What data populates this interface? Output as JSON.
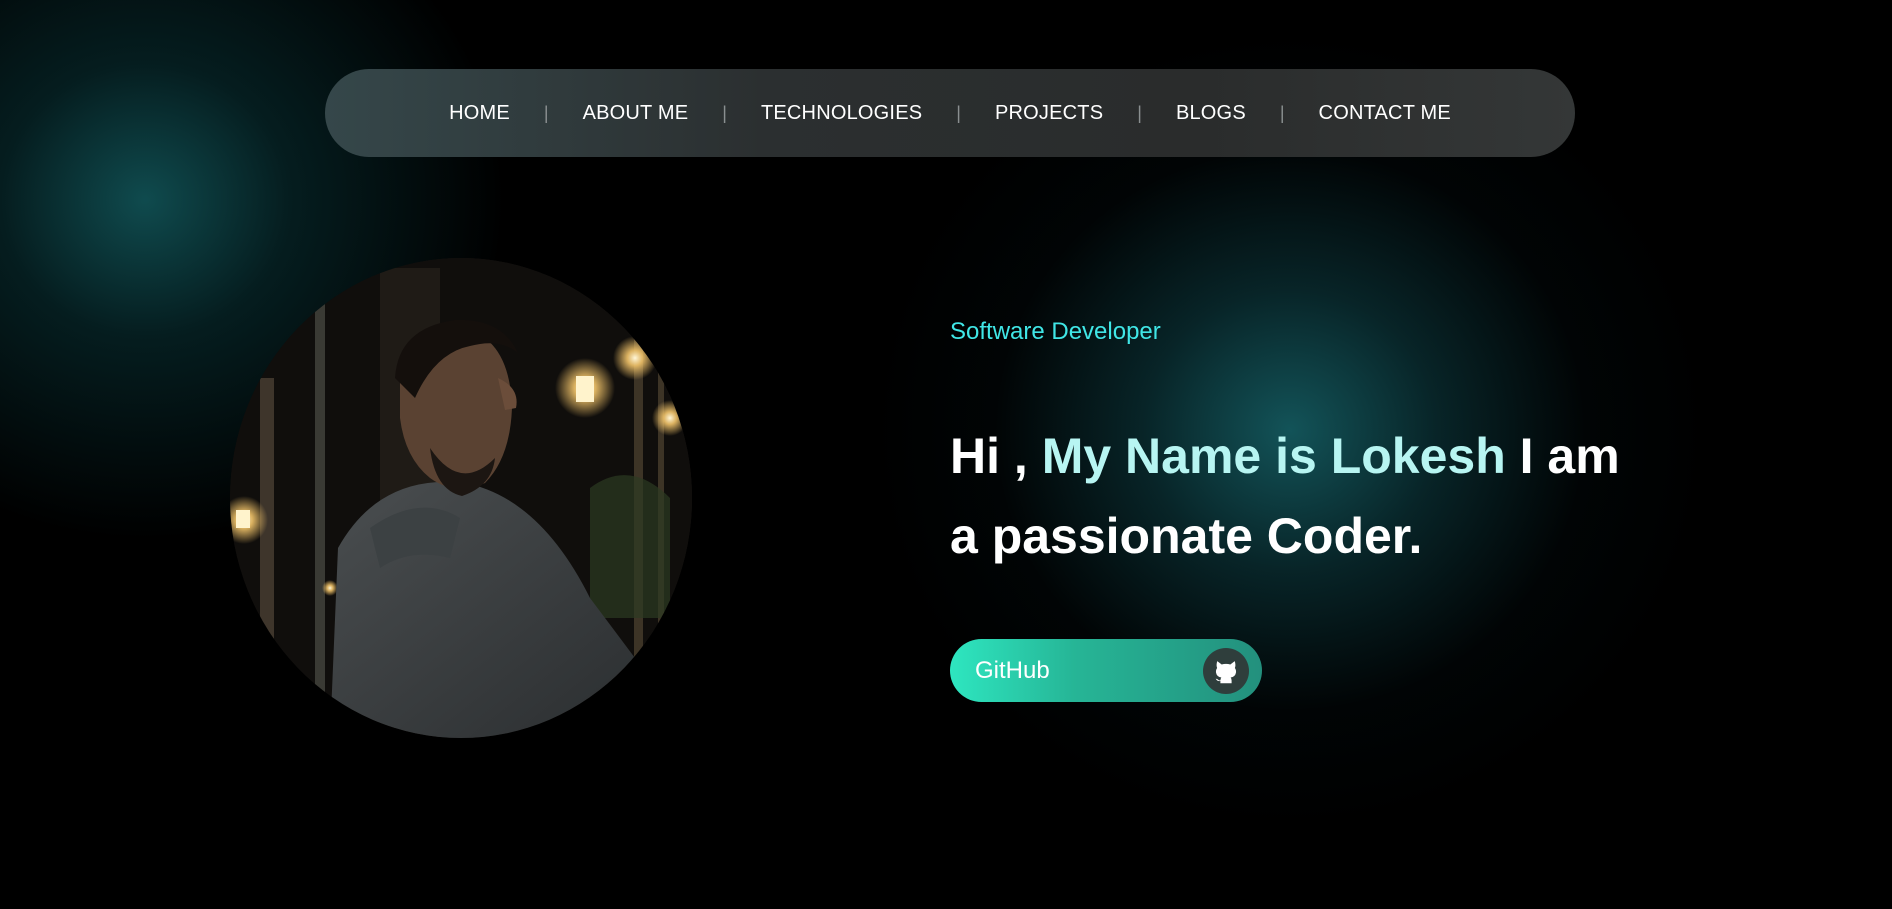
{
  "nav": {
    "items": [
      {
        "label": "HOME"
      },
      {
        "label": "ABOUT ME"
      },
      {
        "label": "TECHNOLOGIES"
      },
      {
        "label": "PROJECTS"
      },
      {
        "label": "BLOGS"
      },
      {
        "label": "CONTACT ME"
      }
    ],
    "separator": "|"
  },
  "hero": {
    "role": "Software Developer",
    "headline_part1": "Hi , ",
    "headline_highlight": "My Name is Lokesh",
    "headline_part2": " I am a passionate Coder.",
    "button_label": "GitHub",
    "button_icon": "github-icon"
  },
  "colors": {
    "accent": "#40e6e6",
    "button_start": "#2ee6c0",
    "button_end": "#23907d",
    "background": "#000000"
  }
}
